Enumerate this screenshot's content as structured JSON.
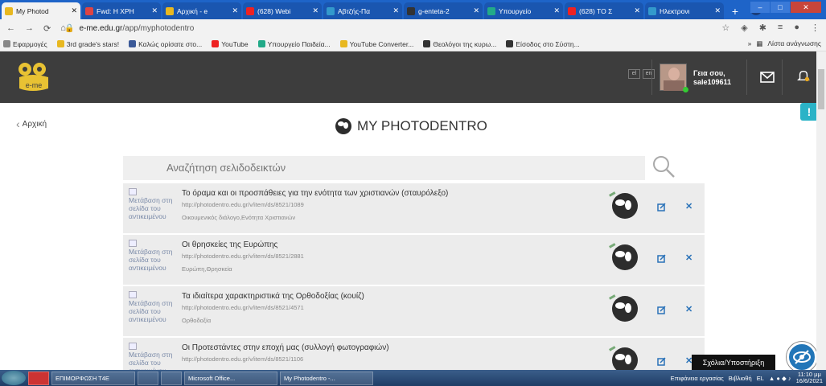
{
  "browser": {
    "tabs": [
      {
        "label": "My Photod",
        "color": "#e8b820",
        "active": true
      },
      {
        "label": "Fwd: Η ΧΡΗ",
        "color": "#d44"
      },
      {
        "label": "Αρχική - e",
        "color": "#e8b820"
      },
      {
        "label": "(628) Webi",
        "color": "#e22"
      },
      {
        "label": "Αβτζής-Πα",
        "color": "#39c"
      },
      {
        "label": "g-enteta-2",
        "color": "#333"
      },
      {
        "label": "Υπουργείο",
        "color": "#2a8"
      },
      {
        "label": "(628) ΤΟ Σ",
        "color": "#e22"
      },
      {
        "label": "Ηλεκτρονι",
        "color": "#39c"
      }
    ],
    "new_tab": "+",
    "url_host": "e-me.edu.gr",
    "url_path": "/app/myphotodentro",
    "bookmarks": [
      {
        "label": "Εφαρμογές",
        "color": "#888"
      },
      {
        "label": "3rd grade's stars!",
        "color": "#e8b820"
      },
      {
        "label": "Καλώς ορίσατε στο...",
        "color": "#3b5998"
      },
      {
        "label": "YouTube",
        "color": "#e22"
      },
      {
        "label": "Υπουργείο Παιδεία...",
        "color": "#2a8"
      },
      {
        "label": "YouTube Converter...",
        "color": "#e8b820"
      },
      {
        "label": "Θεολόγοι της κυρω...",
        "color": "#333"
      },
      {
        "label": "Είσοδος στο Σύστη...",
        "color": "#333"
      }
    ],
    "bookmarks_more": "»",
    "reading_list": "Λίστα ανάγνωσης"
  },
  "header": {
    "lang_el": "el",
    "lang_en": "en",
    "greeting": "Γεια σου,",
    "username": "sale109611"
  },
  "page": {
    "back_label": "Αρχική",
    "title": "MY PHOTODENTRO",
    "help": "!",
    "search_placeholder": "Αναζήτηση σελιδοδεικτών",
    "thumb_alt": "Μετάβαση στη σελίδα του αντικειμένου"
  },
  "items": [
    {
      "title": "Το όραμα και οι προσπάθειες για την ενότητα των χριστιανών (σταυρόλεξο)",
      "url": "http://photodentro.edu.gr/v/item/ds/8521/1089",
      "tags": "Οικουμενικός διάλογο,Ενότητα Χριστιανών"
    },
    {
      "title": "Οι θρησκείες της Ευρώπης",
      "url": "http://photodentro.edu.gr/v/item/ds/8521/2881",
      "tags": "Ευρώπη,Θρησκεία"
    },
    {
      "title": "Τα ιδιαίτερα χαρακτηριστικά της Ορθοδοξίας (κουίζ)",
      "url": "http://photodentro.edu.gr/v/item/ds/8521/4571",
      "tags": "Ορθοδοξία"
    },
    {
      "title": "Οι Προτεστάντες στην εποχή μας (συλλογή φωτογραφιών)",
      "url": "http://photodentro.edu.gr/v/item/ds/8521/1106",
      "tags": ""
    }
  ],
  "tooltip": "Σχόλια/Υποστήριξη",
  "taskbar": {
    "buttons": [
      "ΕΠΙΜΟΡΦΩΣΗ Τ4Ε",
      "",
      "",
      "Microsoft Office...",
      "My Photodentro -..."
    ],
    "desktop": "Επιφάνεια εργασίας",
    "library": "Βιβλιοθή",
    "lang": "EL",
    "time": "11:10 μμ",
    "date": "16/6/2021"
  }
}
